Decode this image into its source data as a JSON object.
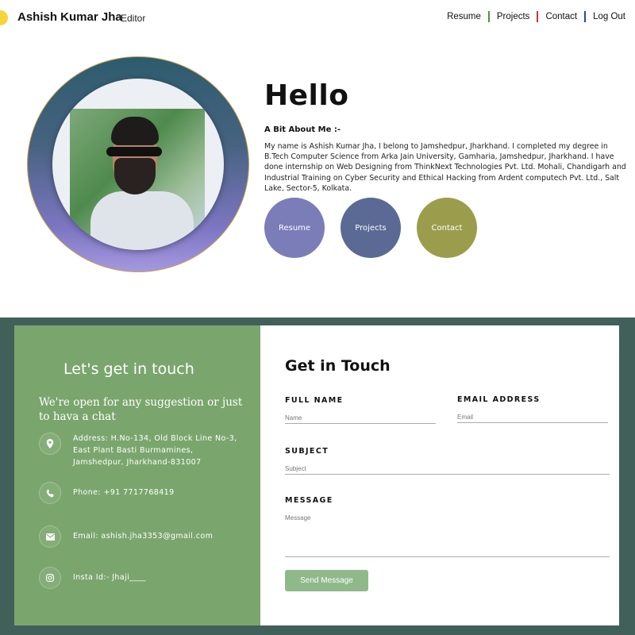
{
  "nav": {
    "brand": "Ashish Kumar Jha",
    "role": "Editor",
    "links": [
      "Resume",
      "Projects",
      "Contact",
      "Log Out"
    ]
  },
  "hero": {
    "greeting": "Hello",
    "about_title": "A Bit About Me :-",
    "about_text": "My name is Ashish Kumar Jha, I belong to Jamshedpur, Jharkhand. I completed my degree in B.Tech Computer Science from Arka Jain University, Gamharia, Jamshedpur, Jharkhand. I have done internship on Web Designing from ThinkNext Technologies Pvt. Ltd. Mohali, Chandigarh and Industrial Training on Cyber Security and Ethical Hacking from Ardent computech Pvt. Ltd., Salt Lake, Sector-5, Kolkata.",
    "buttons": [
      "Resume",
      "Projects",
      "Contact"
    ]
  },
  "contact_info": {
    "title": "Let's get in touch",
    "subtitle": "We're open for any suggestion or just to hava a chat",
    "address_lines": [
      "Address: H.No-134, Old Block Line No-3,",
      "East Plant Basti Burmamines,",
      "Jamshedpur, Jharkhand-831007"
    ],
    "phone": "Phone: +91 7717768419",
    "email": "Email: ashish.jha3353@gmail.com",
    "insta": "Insta Id:- Jhaji____"
  },
  "form": {
    "title": "Get in Touch",
    "full_name_label": "FULL NAME",
    "full_name_placeholder": "Name",
    "email_label": "EMAIL ADDRESS",
    "email_placeholder": "Email",
    "subject_label": "SUBJECT",
    "subject_placeholder": "Subject",
    "message_label": "MESSAGE",
    "message_placeholder": "Message",
    "submit_label": "Send Message"
  },
  "icons": {
    "location": "location-pin-icon",
    "phone": "phone-icon",
    "email": "envelope-icon",
    "insta": "instagram-icon"
  },
  "colors": {
    "accent_green": "#7aa66d",
    "section_bg": "#41605a",
    "resume_btn": "#7b7db8",
    "projects_btn": "#5a6a94",
    "contact_btn": "#9c9d4c",
    "send_btn": "#8fb98a"
  }
}
